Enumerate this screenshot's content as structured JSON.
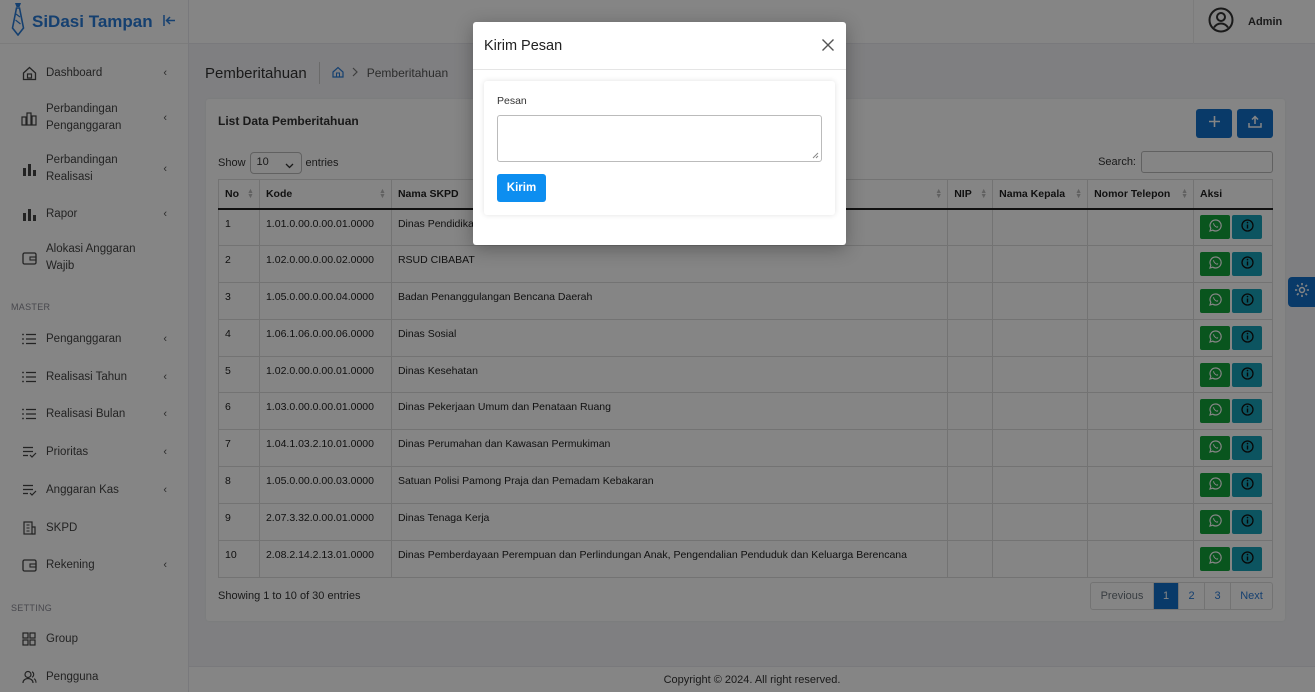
{
  "app": {
    "name": "SiDasi Tampan"
  },
  "user": {
    "name": "Admin"
  },
  "sidebar": {
    "items": [
      {
        "label": "Dashboard"
      },
      {
        "label": "Perbandingan Penganggaran"
      },
      {
        "label": "Perbandingan Realisasi"
      },
      {
        "label": "Rapor"
      },
      {
        "label": "Alokasi Anggaran Wajib"
      }
    ],
    "master_heading": "MASTER",
    "master_items": [
      {
        "label": "Penganggaran"
      },
      {
        "label": "Realisasi Tahun"
      },
      {
        "label": "Realisasi Bulan"
      },
      {
        "label": "Prioritas"
      },
      {
        "label": "Anggaran Kas"
      },
      {
        "label": "SKPD"
      },
      {
        "label": "Rekening"
      }
    ],
    "setting_heading": "SETTING",
    "setting_items": [
      {
        "label": "Group"
      },
      {
        "label": "Pengguna"
      }
    ]
  },
  "page": {
    "title": "Pemberitahuan",
    "breadcrumb": "Pemberitahuan"
  },
  "card": {
    "title": "List Data Pemberitahuan",
    "show_label": "Show",
    "show_value": "10",
    "entries_label": "entries",
    "search_label": "Search:",
    "columns": [
      "No",
      "Kode",
      "Nama SKPD",
      "NIP",
      "Nama Kepala",
      "Nomor Telepon",
      "Aksi"
    ],
    "rows": [
      {
        "no": "1",
        "kode": "1.01.0.00.0.00.01.0000",
        "nama": "Dinas Pendidikan",
        "nip": "",
        "kepala": "",
        "telepon": ""
      },
      {
        "no": "2",
        "kode": "1.02.0.00.0.00.02.0000",
        "nama": "RSUD CIBABAT",
        "nip": "",
        "kepala": "",
        "telepon": ""
      },
      {
        "no": "3",
        "kode": "1.05.0.00.0.00.04.0000",
        "nama": "Badan Penanggulangan Bencana Daerah",
        "nip": "",
        "kepala": "",
        "telepon": ""
      },
      {
        "no": "4",
        "kode": "1.06.1.06.0.00.06.0000",
        "nama": "Dinas Sosial",
        "nip": "",
        "kepala": "",
        "telepon": ""
      },
      {
        "no": "5",
        "kode": "1.02.0.00.0.00.01.0000",
        "nama": "Dinas Kesehatan",
        "nip": "",
        "kepala": "",
        "telepon": ""
      },
      {
        "no": "6",
        "kode": "1.03.0.00.0.00.01.0000",
        "nama": "Dinas Pekerjaan Umum dan Penataan Ruang",
        "nip": "",
        "kepala": "",
        "telepon": ""
      },
      {
        "no": "7",
        "kode": "1.04.1.03.2.10.01.0000",
        "nama": "Dinas Perumahan dan Kawasan Permukiman",
        "nip": "",
        "kepala": "",
        "telepon": ""
      },
      {
        "no": "8",
        "kode": "1.05.0.00.0.00.03.0000",
        "nama": "Satuan Polisi Pamong Praja dan Pemadam Kebakaran",
        "nip": "",
        "kepala": "",
        "telepon": ""
      },
      {
        "no": "9",
        "kode": "2.07.3.32.0.00.01.0000",
        "nama": "Dinas Tenaga Kerja",
        "nip": "",
        "kepala": "",
        "telepon": ""
      },
      {
        "no": "10",
        "kode": "2.08.2.14.2.13.01.0000",
        "nama": "Dinas Pemberdayaan Perempuan dan Perlindungan Anak, Pengendalian Penduduk dan Keluarga Berencana",
        "nip": "",
        "kepala": "",
        "telepon": ""
      }
    ],
    "info": "Showing 1 to 10 of 30 entries",
    "pagination": {
      "previous": "Previous",
      "pages": [
        "1",
        "2",
        "3"
      ],
      "next": "Next",
      "current": "1"
    }
  },
  "footer": {
    "text": "Copyright © 2024. All right reserved."
  },
  "modal": {
    "title": "Kirim Pesan",
    "field_label": "Pesan",
    "field_value": "",
    "submit_label": "Kirim"
  },
  "colors": {
    "primary": "#1370c9",
    "brand": "#2a7bd6",
    "whatsapp": "#12a43b",
    "info": "#17a2b8",
    "submit": "#0d8ef0"
  }
}
